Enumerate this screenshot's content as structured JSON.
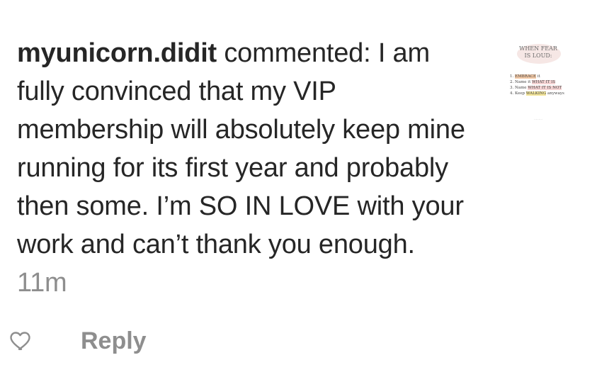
{
  "comment": {
    "username": "myunicorn.didit",
    "action": "commented:",
    "text": "I am fully convinced that my VIP membership will absolutely keep mine running for its first year and probably then some. I’m SO IN LOVE with your work and can’t thank you enough.",
    "time": "11m"
  },
  "post_thumbnail": {
    "title_line1": "WHEN FEAR",
    "title_line2": "IS LOUD:",
    "list": [
      {
        "prefix": "1. ",
        "highlight": "EMBRACE",
        "suffix": " it"
      },
      {
        "prefix": "2. Name it ",
        "highlight": "WHAT IT IS",
        "suffix": ""
      },
      {
        "prefix": "3. Name ",
        "highlight": "WHAT IT IS NOT",
        "suffix": ""
      },
      {
        "prefix": "4. Keep ",
        "highlight": "WALKING",
        "suffix": " anyways"
      }
    ]
  },
  "actions": {
    "reply_label": "Reply",
    "like_icon": "heart-outline-icon"
  },
  "colors": {
    "text": "#262626",
    "muted": "#8e8e8e",
    "background": "#ffffff"
  }
}
